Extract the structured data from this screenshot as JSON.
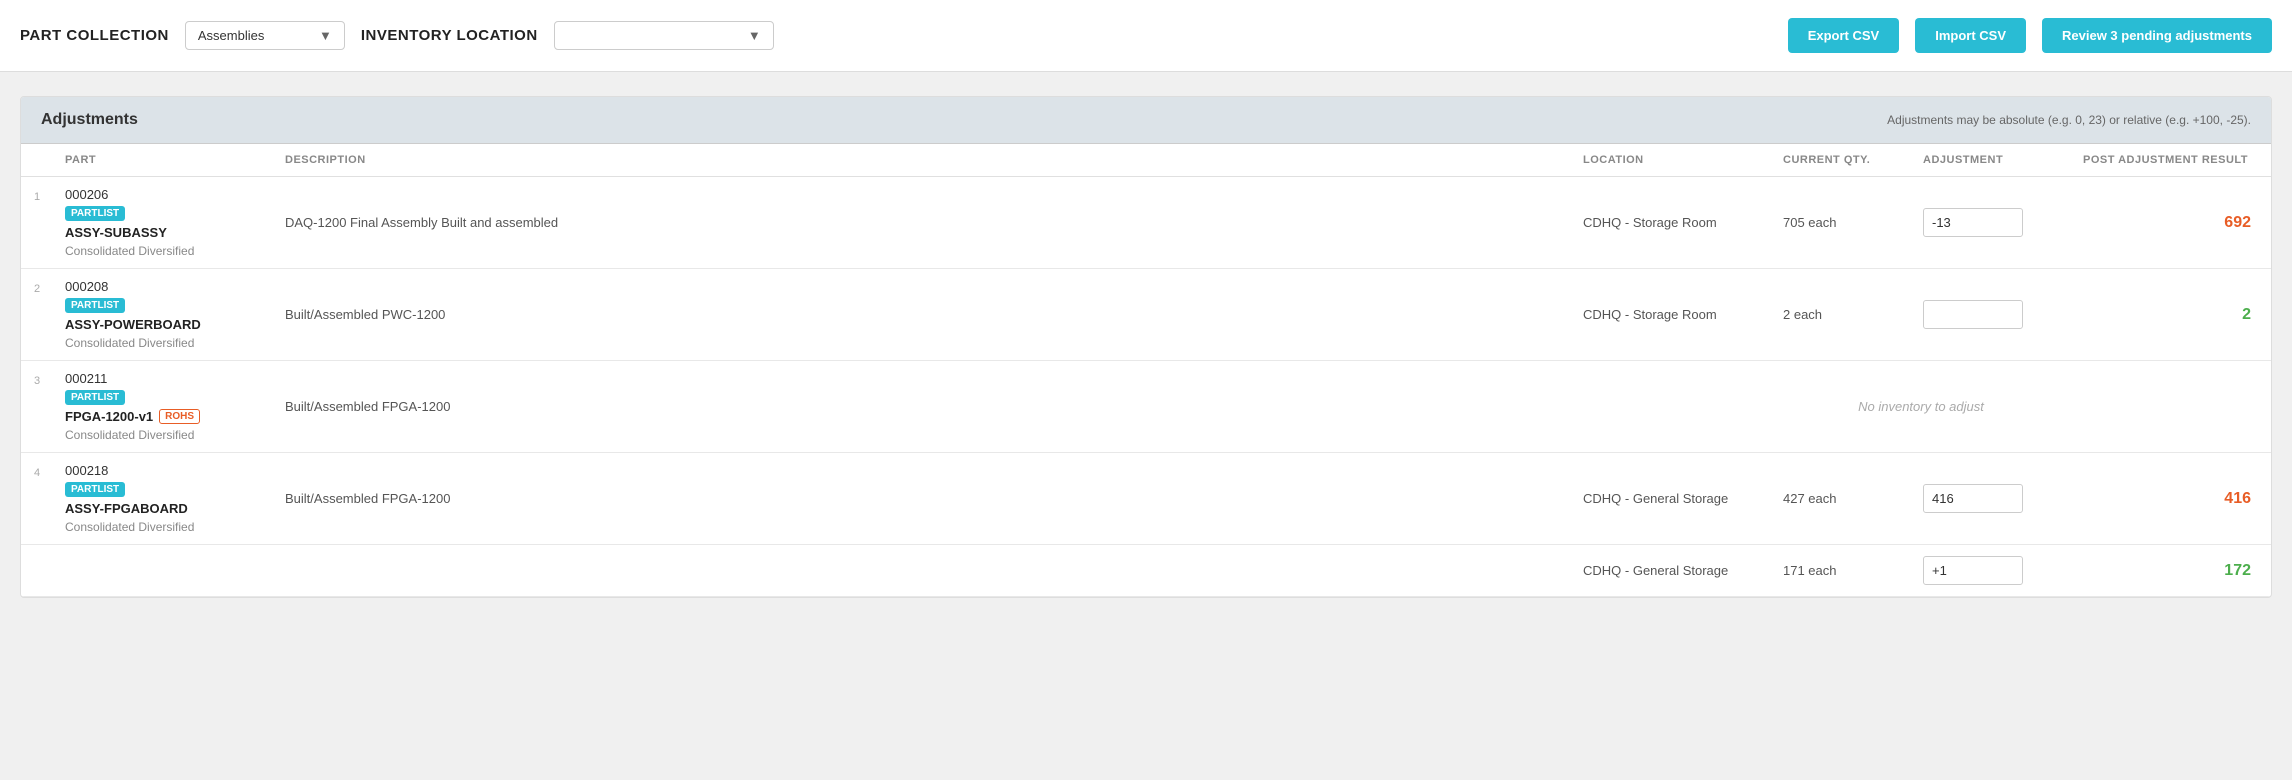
{
  "header": {
    "part_collection_label": "PART COLLECTION",
    "part_collection_value": "Assemblies",
    "inventory_location_label": "INVENTORY LOCATION",
    "inventory_location_placeholder": "",
    "export_csv_label": "Export CSV",
    "import_csv_label": "Import CSV",
    "review_pending_label": "Review 3 pending adjustments"
  },
  "table": {
    "title": "Adjustments",
    "subtitle": "Adjustments may be absolute (e.g. 0, 23) or relative (e.g. +100, -25).",
    "columns": {
      "num": "",
      "part": "PART",
      "description": "DESCRIPTION",
      "location": "LOCATION",
      "current_qty": "CURRENT QTY.",
      "adjustment": "ADJUSTMENT",
      "post_adjustment": "POST ADJUSTMENT RESULT"
    },
    "rows": [
      {
        "num": "1",
        "part_number": "000206",
        "part_badge": "PARTLIST",
        "part_name": "ASSY-SUBASSY",
        "part_company": "Consolidated Diversified",
        "rohs": false,
        "description": "DAQ-1200 Final Assembly Built and assembled",
        "location": "CDHQ - Storage Room",
        "current_qty": "705 each",
        "adjustment_value": "-13",
        "post_adjustment": "692",
        "post_adjustment_color": "red",
        "no_inventory": false
      },
      {
        "num": "2",
        "part_number": "000208",
        "part_badge": "PARTLIST",
        "part_name": "ASSY-POWERBOARD",
        "part_company": "Consolidated Diversified",
        "rohs": false,
        "description": "Built/Assembled PWC-1200",
        "location": "CDHQ - Storage Room",
        "current_qty": "2 each",
        "adjustment_value": "",
        "post_adjustment": "2",
        "post_adjustment_color": "green",
        "no_inventory": false
      },
      {
        "num": "3",
        "part_number": "000211",
        "part_badge": "PARTLIST",
        "part_name": "FPGA-1200-v1",
        "part_company": "Consolidated Diversified",
        "rohs": true,
        "description": "Built/Assembled FPGA-1200",
        "location": "",
        "current_qty": "",
        "adjustment_value": "",
        "post_adjustment": "",
        "post_adjustment_color": "",
        "no_inventory": true,
        "no_inventory_text": "No inventory to adjust"
      },
      {
        "num": "4",
        "part_number": "000218",
        "part_badge": "PARTLIST",
        "part_name": "ASSY-FPGABOARD",
        "part_company": "Consolidated Diversified",
        "rohs": false,
        "description": "Built/Assembled FPGA-1200",
        "location": "CDHQ - General Storage",
        "current_qty": "427 each",
        "adjustment_value": "416",
        "post_adjustment": "416",
        "post_adjustment_color": "red",
        "no_inventory": false,
        "sub_row": {
          "location": "CDHQ - General Storage",
          "current_qty": "171 each",
          "adjustment_value": "+1",
          "post_adjustment": "172",
          "post_adjustment_color": "green"
        }
      }
    ]
  }
}
